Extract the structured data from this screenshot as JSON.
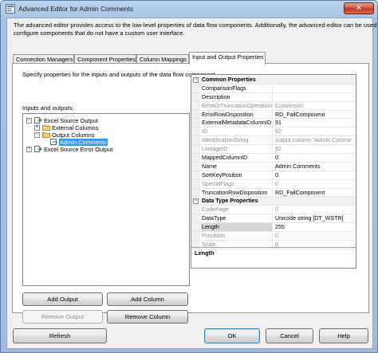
{
  "window": {
    "title": "Advanced Editor for Admin Comments",
    "close_label": "✕"
  },
  "description": {
    "line1": "The advanced editor provides access to the low-level properties of data flow components. Additionally, the advanced editor can be used to",
    "line2": "configure components that do not have a custom user interface."
  },
  "tabs": [
    {
      "label": "Connection Managers"
    },
    {
      "label": "Component Properties"
    },
    {
      "label": "Column Mappings"
    },
    {
      "label": "Input and Output Properties"
    }
  ],
  "panel": {
    "description": "Specify properties for the inputs and outputs of the data flow component.",
    "io_label": "Inputs and outputs:"
  },
  "tree": {
    "nodes": [
      {
        "label": "Excel Source Output",
        "expander": "−"
      },
      {
        "label": "External Columns",
        "expander": "+"
      },
      {
        "label": "Output Columns",
        "expander": "−"
      },
      {
        "label": "Admin Comments",
        "expander": ""
      },
      {
        "label": "Excel Source Error Output",
        "expander": "+"
      }
    ]
  },
  "buttons": {
    "add_output": "Add Output",
    "add_column": "Add Column",
    "remove_output": "Remove Output",
    "remove_column": "Remove Column",
    "refresh": "Refresh",
    "ok": "OK",
    "cancel": "Cancel",
    "help": "Help"
  },
  "properties": {
    "common_header": "Common Properties",
    "common": [
      {
        "name": "ComparisonFlags",
        "value": "",
        "readonly": false
      },
      {
        "name": "Description",
        "value": "",
        "readonly": false
      },
      {
        "name": "ErrorOrTruncationOperation",
        "value": "Conversion",
        "readonly": true
      },
      {
        "name": "ErrorRowDisposition",
        "value": "RD_FailComponent",
        "readonly": false
      },
      {
        "name": "ExternalMetadataColumnID",
        "value": "91",
        "readonly": false
      },
      {
        "name": "ID",
        "value": "92",
        "readonly": true
      },
      {
        "name": "IdentificationString",
        "value": "output column \"Admin Comme",
        "readonly": true
      },
      {
        "name": "LineageID",
        "value": "92",
        "readonly": true
      },
      {
        "name": "MappedColumnID",
        "value": "0",
        "readonly": false
      },
      {
        "name": "Name",
        "value": "Admin Comments",
        "readonly": false
      },
      {
        "name": "SortKeyPosition",
        "value": "0",
        "readonly": false
      },
      {
        "name": "SpecialFlags",
        "value": "0",
        "readonly": true
      },
      {
        "name": "TruncationRowDisposition",
        "value": "RD_FailComponent",
        "readonly": false
      }
    ],
    "datatype_header": "Data Type Properties",
    "datatype": [
      {
        "name": "CodePage",
        "value": "0",
        "readonly": true
      },
      {
        "name": "DataType",
        "value": "Unicode string [DT_WSTR]",
        "readonly": false
      },
      {
        "name": "Length",
        "value": "255",
        "readonly": false
      },
      {
        "name": "Precision",
        "value": "0",
        "readonly": true
      },
      {
        "name": "Scale",
        "value": "0",
        "readonly": true
      }
    ],
    "selected_description": "Length"
  }
}
